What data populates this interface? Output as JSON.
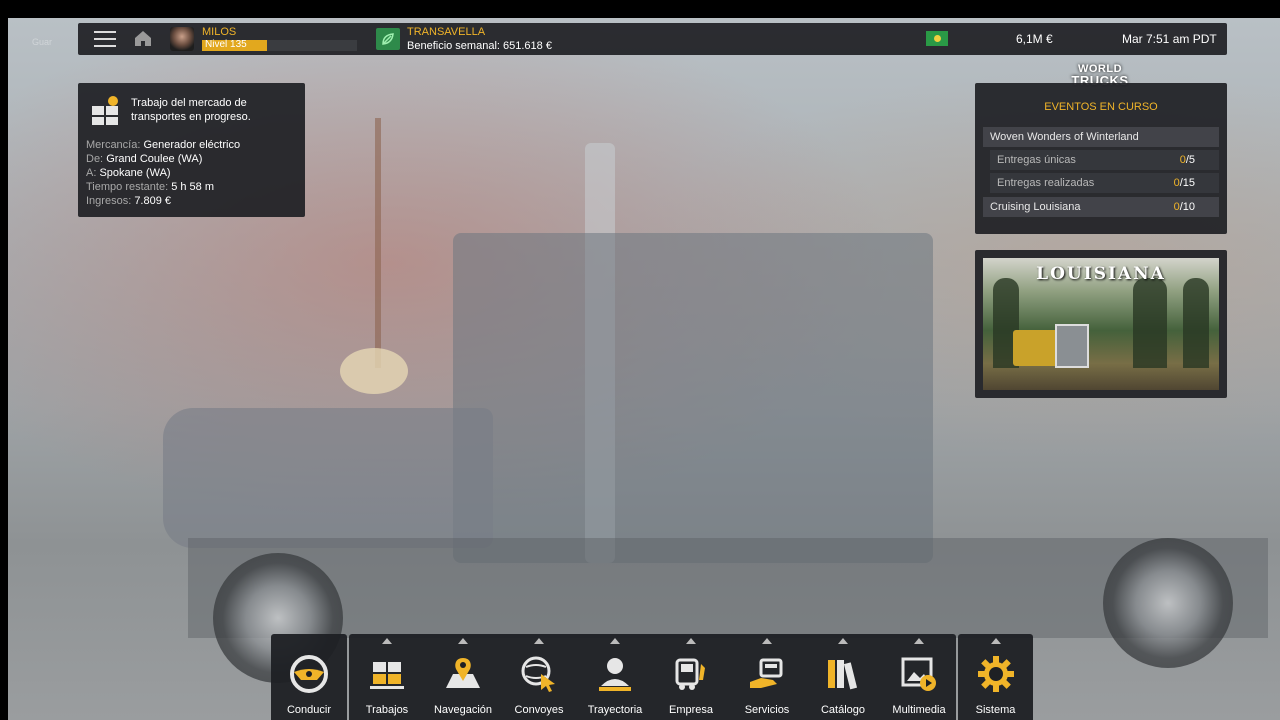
{
  "colors": {
    "accent": "#f0b429",
    "panel": "#1e2024",
    "company": "#2e8a4a"
  },
  "topbar": {
    "player_name": "MILOS",
    "level_label": "Nivel 135",
    "level_progress": 0.42,
    "company_name": "TRANSAVELLA",
    "weekly_profit": "Beneficio semanal: 651.618 €",
    "money": "6,1M  €",
    "clock": "Mar 7:51 am PDT",
    "left_ghost_text": "Guar"
  },
  "job": {
    "title": "Trabajo del mercado de transportes en progreso.",
    "rows": [
      {
        "label": "Mercancía: ",
        "value": "Generador eléctrico"
      },
      {
        "label": "De: ",
        "value": "Grand Coulee (WA)"
      },
      {
        "label": "A: ",
        "value": "Spokane (WA)"
      },
      {
        "label": "Tiempo restante: ",
        "value": "5 h 58 m"
      },
      {
        "label": "Ingresos: ",
        "value": "7.809 €"
      }
    ]
  },
  "events": {
    "logo_line1": "WORLD",
    "logo_line2": "TRUCKS",
    "title": "EVENTOS EN CURSO",
    "rows": [
      {
        "name": "Woven Wonders of Winterland",
        "done": "",
        "total": ""
      },
      {
        "name": "Entregas únicas",
        "done": "0",
        "total": "/5"
      },
      {
        "name": "Entregas realizadas",
        "done": "0",
        "total": "/15"
      },
      {
        "name": "Cruising Louisiana",
        "done": "0",
        "total": "/10"
      }
    ]
  },
  "promo": {
    "title": "LOUISIANA"
  },
  "dock": [
    {
      "label": "Conducir",
      "icon": "steering-wheel-icon"
    },
    {
      "label": "Trabajos",
      "icon": "cargo-boxes-icon"
    },
    {
      "label": "Navegación",
      "icon": "map-pin-icon"
    },
    {
      "label": "Convoyes",
      "icon": "globe-cursor-icon"
    },
    {
      "label": "Trayectoria",
      "icon": "profile-icon"
    },
    {
      "label": "Empresa",
      "icon": "truck-wrench-icon"
    },
    {
      "label": "Servicios",
      "icon": "service-hand-icon"
    },
    {
      "label": "Catálogo",
      "icon": "books-icon"
    },
    {
      "label": "Multimedia",
      "icon": "media-image-icon"
    },
    {
      "label": "Sistema",
      "icon": "gear-icon"
    }
  ]
}
